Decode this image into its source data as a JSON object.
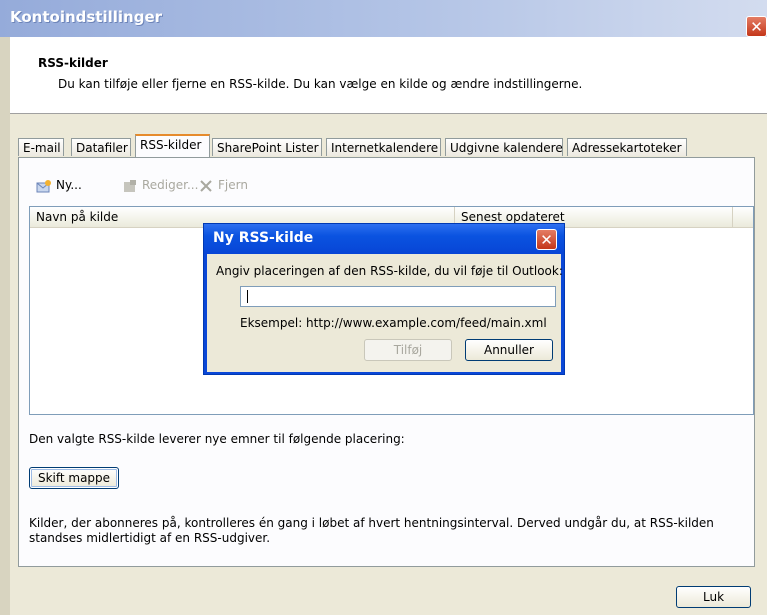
{
  "window": {
    "title": "Kontoindstillinger",
    "close_symbol": "✕"
  },
  "header": {
    "title": "RSS-kilder",
    "description": "Du kan tilføje eller fjerne en RSS-kilde. Du kan vælge en kilde og ændre indstillingerne."
  },
  "tabs": [
    {
      "label": "E-mail"
    },
    {
      "label": "Datafiler"
    },
    {
      "label": "RSS-kilder"
    },
    {
      "label": "SharePoint Lister"
    },
    {
      "label": "Internetkalendere"
    },
    {
      "label": "Udgivne kalendere"
    },
    {
      "label": "Adressekartoteker"
    }
  ],
  "toolbar": {
    "new_label": "Ny...",
    "edit_label": "Rediger...",
    "delete_label": "Fjern"
  },
  "list": {
    "col_name": "Navn på kilde",
    "col_updated": "Senest opdateret"
  },
  "delivery": {
    "label": "Den valgte RSS-kilde leverer nye emner til følgende placering:",
    "change_folder_button": "Skift mappe"
  },
  "info_text": "Kilder, der abonneres på, kontrolleres én gang i løbet af hvert hentningsinterval. Derved undgår du, at RSS-kilden standses midlertidigt af en RSS-udgiver.",
  "footer": {
    "close_button": "Luk"
  },
  "dialog": {
    "title": "Ny RSS-kilde",
    "prompt": "Angiv placeringen af den RSS-kilde, du vil føje til Outlook:",
    "input_value": "",
    "example": "Eksempel: http://www.example.com/feed/main.xml",
    "add_button": "Tilføj",
    "cancel_button": "Annuller",
    "close_symbol": "✕"
  }
}
